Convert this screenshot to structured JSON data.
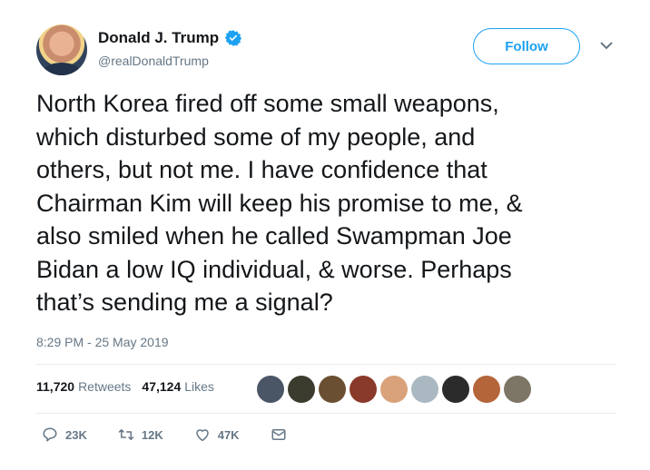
{
  "author": {
    "display_name": "Donald J. Trump",
    "handle": "@realDonaldTrump",
    "verified": true,
    "verified_color": "#1da1f2"
  },
  "follow_button": {
    "label": "Follow",
    "color": "#1da1f2"
  },
  "tweet": {
    "text": "North Korea fired off some small weapons,\nwhich disturbed some of my people, and\nothers, but not me. I have confidence that\nChairman Kim will keep his promise to me, &\nalso smiled when he called Swampman Joe\nBidan a low IQ individual, & worse. Perhaps\nthat’s sending me a signal?",
    "timestamp": "8:29 PM - 25 May 2019"
  },
  "stats": {
    "retweets_count": "11,720",
    "retweets_label": "Retweets",
    "likes_count": "47,124",
    "likes_label": "Likes"
  },
  "likers_colors": [
    "#4a5566",
    "#3c3c2e",
    "#6b4f32",
    "#8a3a2a",
    "#d9a27a",
    "#aab8c2",
    "#2b2b2b",
    "#b5653a",
    "#7d7565"
  ],
  "actions": {
    "reply_count": "23K",
    "retweet_count": "12K",
    "like_count": "47K"
  },
  "icons": [
    "verified-badge-icon",
    "chevron-down-icon",
    "reply-icon",
    "retweet-icon",
    "like-icon",
    "direct-message-icon"
  ]
}
